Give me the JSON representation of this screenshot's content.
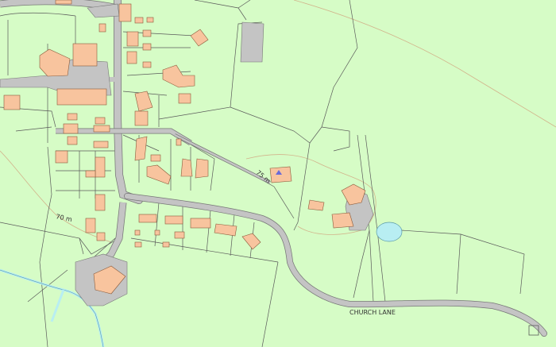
{
  "map": {
    "colors": {
      "land": "#d6fcc6",
      "building": "#f8c49e",
      "road": "#c4c4c4",
      "water": "#b8eef2",
      "line": "#5a5a5a",
      "contour": "#d2b48c"
    },
    "labels": {
      "street": "CHURCH LANE",
      "contour_70": "70 m",
      "contour_75": "75 m"
    }
  }
}
